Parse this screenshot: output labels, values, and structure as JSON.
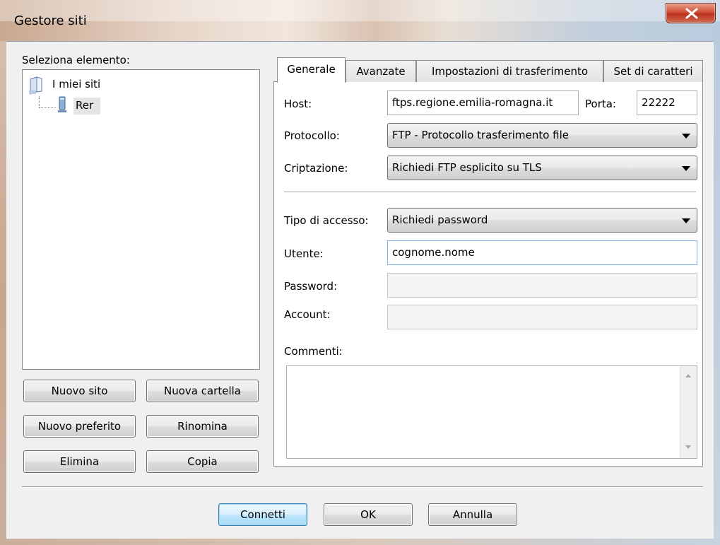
{
  "window": {
    "title": "Gestore siti",
    "close_icon": "close-icon"
  },
  "left": {
    "select_label": "Seleziona elemento:",
    "tree": {
      "root": {
        "label": "I miei siti",
        "icon": "folder-icon"
      },
      "children": [
        {
          "label": "Rer",
          "icon": "server-icon",
          "selected": true
        }
      ]
    },
    "buttons": {
      "new_site": "Nuovo sito",
      "new_folder": "Nuova cartella",
      "new_bookmark": "Nuovo preferito",
      "rename": "Rinomina",
      "delete": "Elimina",
      "copy": "Copia"
    }
  },
  "tabs": [
    {
      "label": "Generale",
      "active": true
    },
    {
      "label": "Avanzate"
    },
    {
      "label": "Impostazioni di trasferimento"
    },
    {
      "label": "Set di caratteri"
    }
  ],
  "general": {
    "host_label": "Host:",
    "host_value": "ftps.regione.emilia-romagna.it",
    "port_label": "Porta:",
    "port_value": "22222",
    "protocol_label": "Protocollo:",
    "protocol_value": "FTP - Protocollo trasferimento file",
    "encryption_label": "Criptazione:",
    "encryption_value": "Richiedi FTP esplicito su TLS",
    "logon_label": "Tipo di accesso:",
    "logon_value": "Richiedi password",
    "user_label": "Utente:",
    "user_value": "cognome.nome",
    "password_label": "Password:",
    "password_value": "",
    "account_label": "Account:",
    "account_value": "",
    "comments_label": "Commenti:",
    "comments_value": ""
  },
  "footer": {
    "connect": "Connetti",
    "ok": "OK",
    "cancel": "Annulla"
  }
}
